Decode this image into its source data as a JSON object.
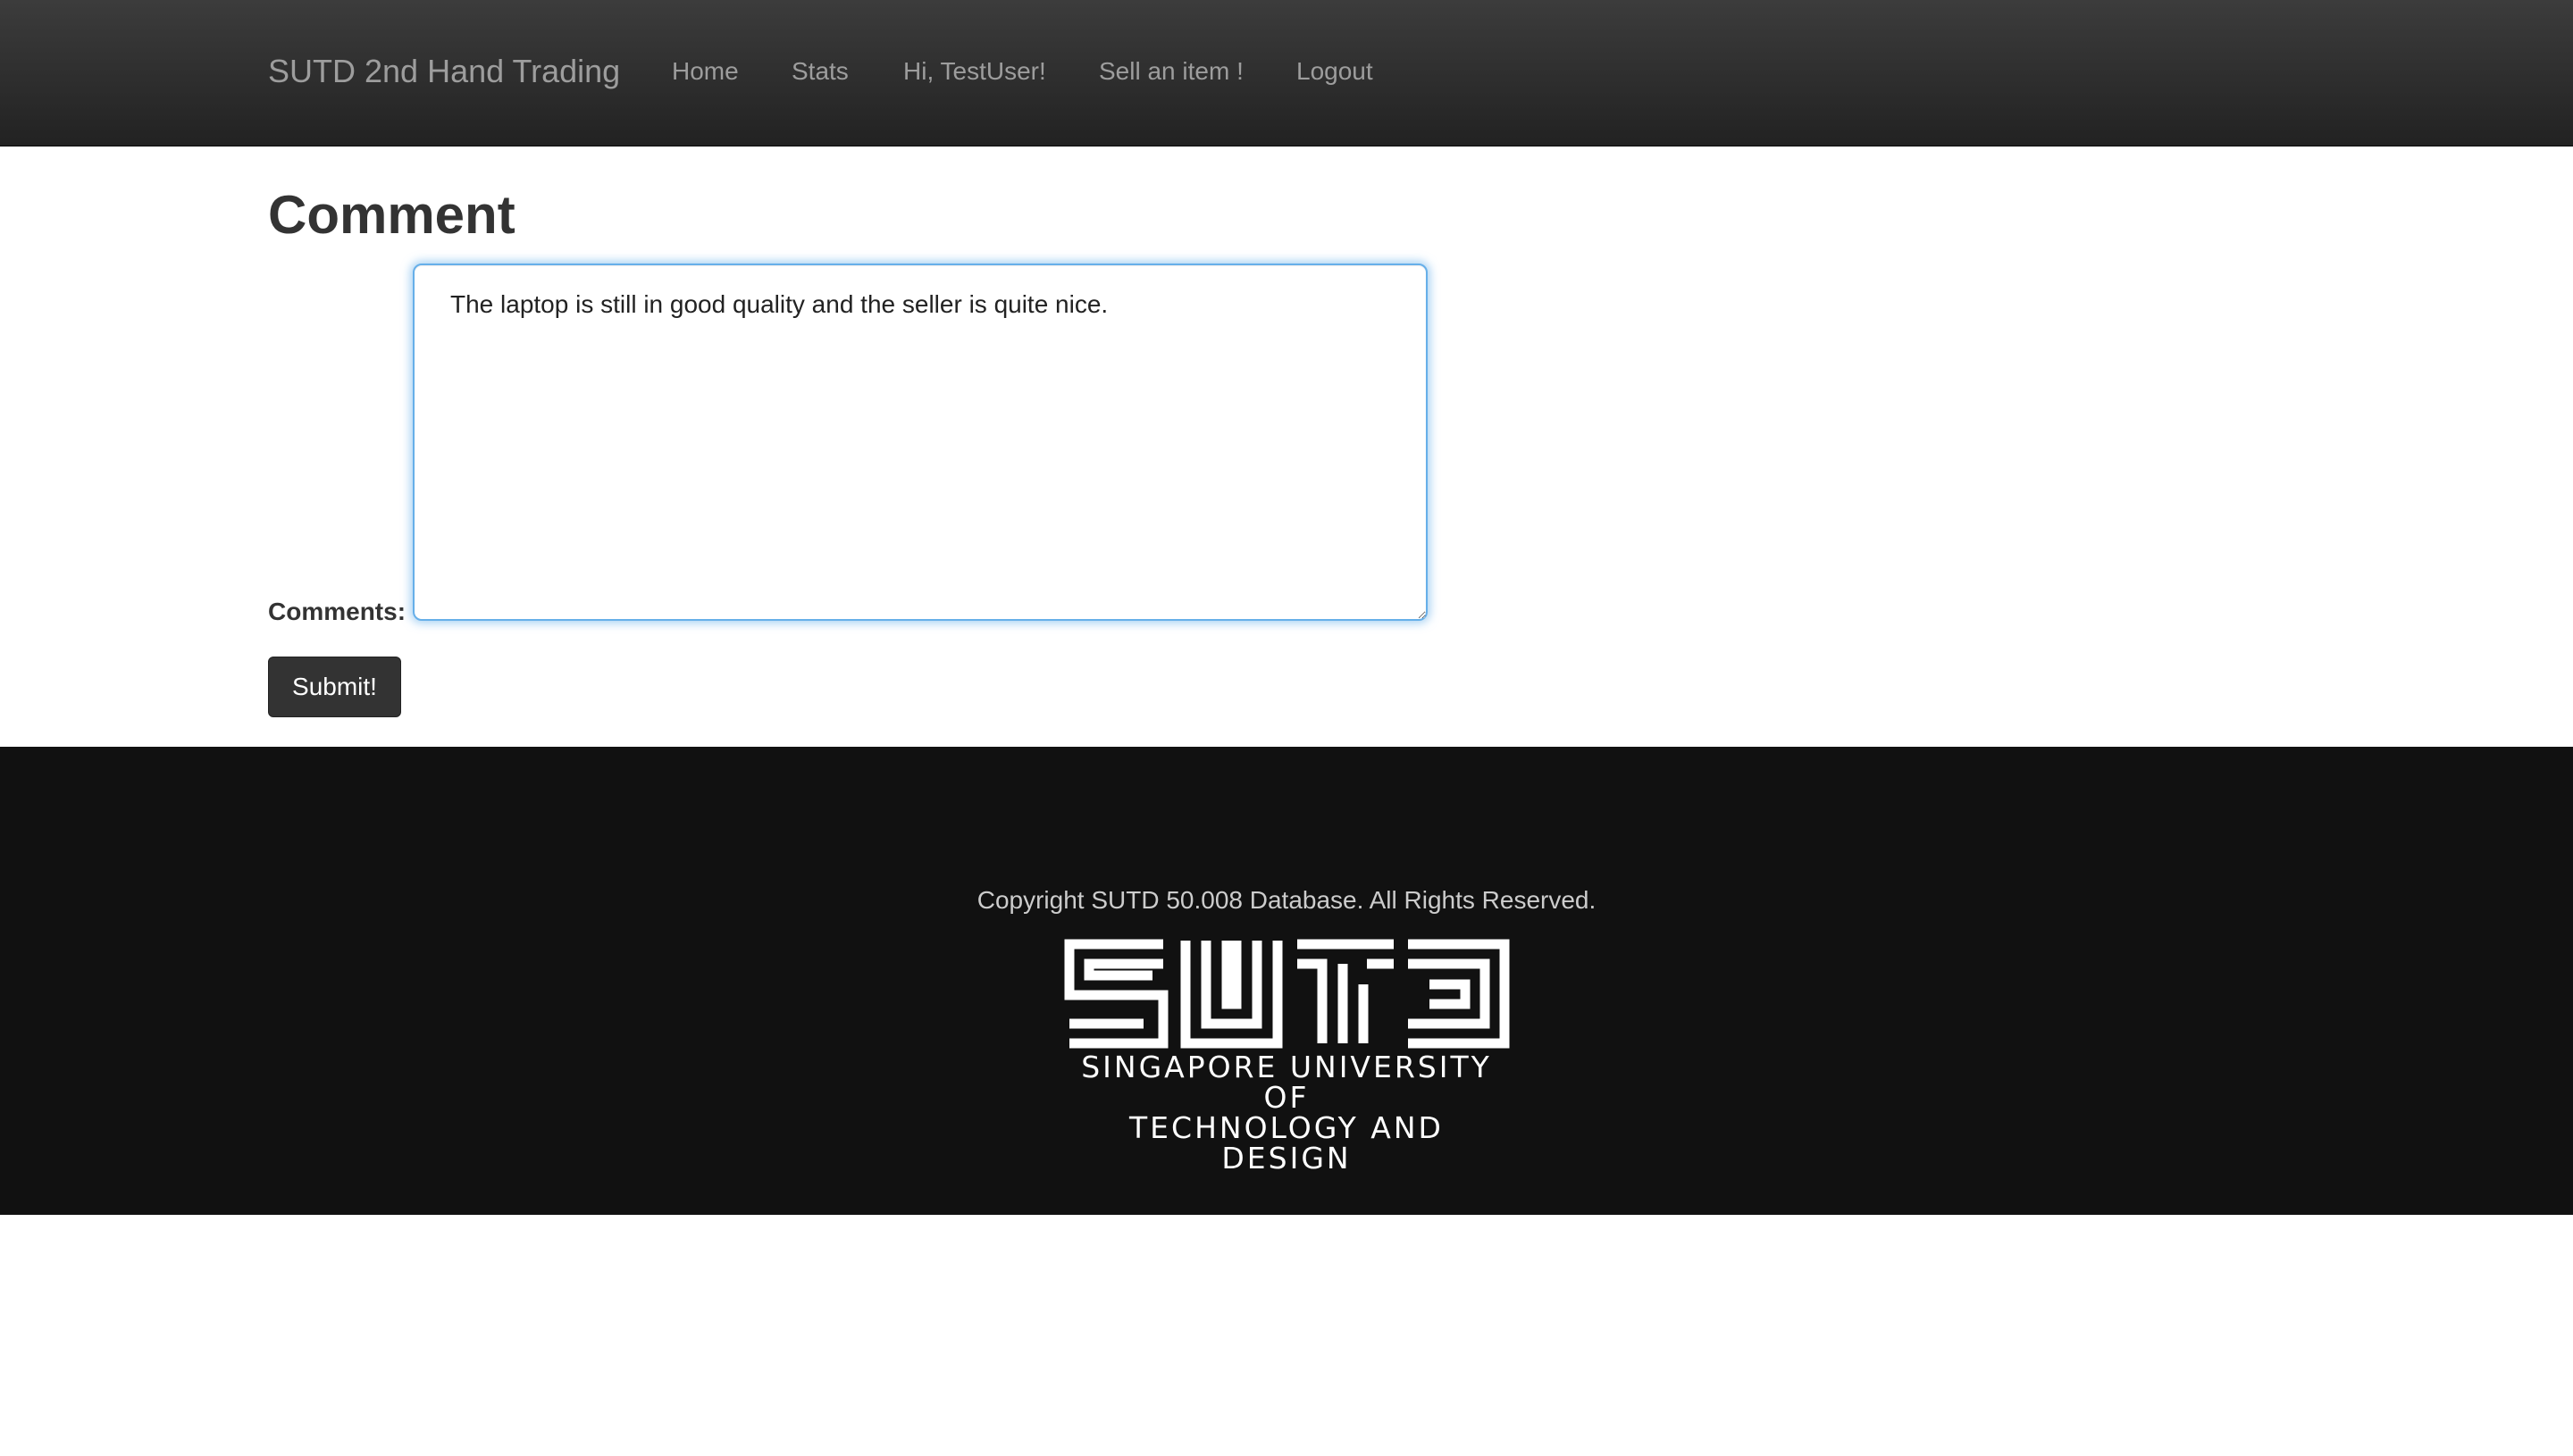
{
  "navbar": {
    "brand": "SUTD 2nd Hand Trading",
    "links": [
      {
        "label": "Home"
      },
      {
        "label": "Stats"
      },
      {
        "label": "Hi, TestUser!"
      },
      {
        "label": "Sell an item !"
      },
      {
        "label": "Logout"
      }
    ]
  },
  "main": {
    "title": "Comment",
    "comments_label": "Comments:",
    "comment_value": "The laptop is still in good quality and the seller is quite nice.",
    "submit_label": "Submit!"
  },
  "footer": {
    "copyright": "Copyright SUTD 50.008 Database. All Rights Reserved.",
    "logo": {
      "wordmark": "SUTD",
      "tagline_line1": "SINGAPORE UNIVERSITY OF",
      "tagline_line2": "TECHNOLOGY AND DESIGN"
    }
  },
  "colors": {
    "navbar": "#222222",
    "nav_text": "#9d9d9d",
    "focus_border": "#66afe9",
    "button": "#333333",
    "footer": "#111111"
  }
}
